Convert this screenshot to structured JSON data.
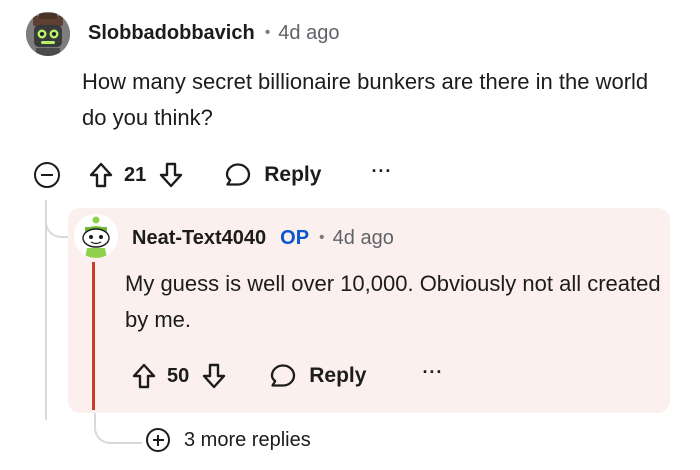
{
  "parent_comment": {
    "username": "Slobbadobbavich",
    "separator": "•",
    "age": "4d ago",
    "text": "How many secret billionaire bunkers are there in the world do you think?",
    "score": "21",
    "reply_label": "Reply",
    "more_label": "···",
    "avatar_icon": "robot-avatar-icon"
  },
  "reply_comment": {
    "username": "Neat-Text4040",
    "op_badge": "OP",
    "separator": "•",
    "age": "4d ago",
    "text": "My guess is well over 10,000. Obviously not all created by me.",
    "score": "50",
    "reply_label": "Reply",
    "more_label": "···",
    "avatar_icon": "snoo-avatar-icon"
  },
  "more_replies": {
    "label": "3 more replies"
  },
  "colors": {
    "text": "#1c1c1c",
    "meta": "#5f6368",
    "op_badge": "#0b57d0",
    "highlight_bg": "#fbf0ee",
    "highlight_accent": "#cc3a2a",
    "thread_line": "#d7dadc"
  }
}
